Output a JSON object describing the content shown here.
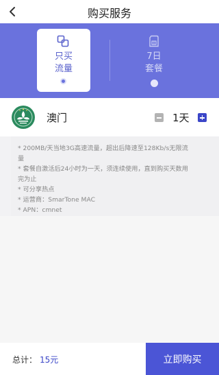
{
  "header": {
    "title": "购买服务"
  },
  "tabs": [
    {
      "line1": "只买",
      "line2": "流量",
      "selected": true,
      "icon": "overlap-squares-icon"
    },
    {
      "line1": "7日",
      "line2": "套餐",
      "selected": false,
      "icon": "sim-card-icon"
    }
  ],
  "product": {
    "region": "澳门",
    "duration": "1天",
    "logo": "macau-emblem-icon",
    "colors": {
      "logo_green": "#2b8a5e",
      "accent": "#3b46c8"
    }
  },
  "description": [
    "* 200MB/天当地3G高速流量，超出后降速至128Kb/s无限流",
    "量",
    "* 套餐自激活后24小时为一天，须连续使用，直到购买天数用",
    "完为止",
    "* 可分享热点",
    "* 运营商：SmarTone MAC",
    "* APN：cmnet"
  ],
  "footer": {
    "total_label": "总计：",
    "total_value": "15元",
    "buy_label": "立即购买"
  },
  "theme": {
    "banner": "#6a72dd",
    "button": "#4b55d6"
  }
}
